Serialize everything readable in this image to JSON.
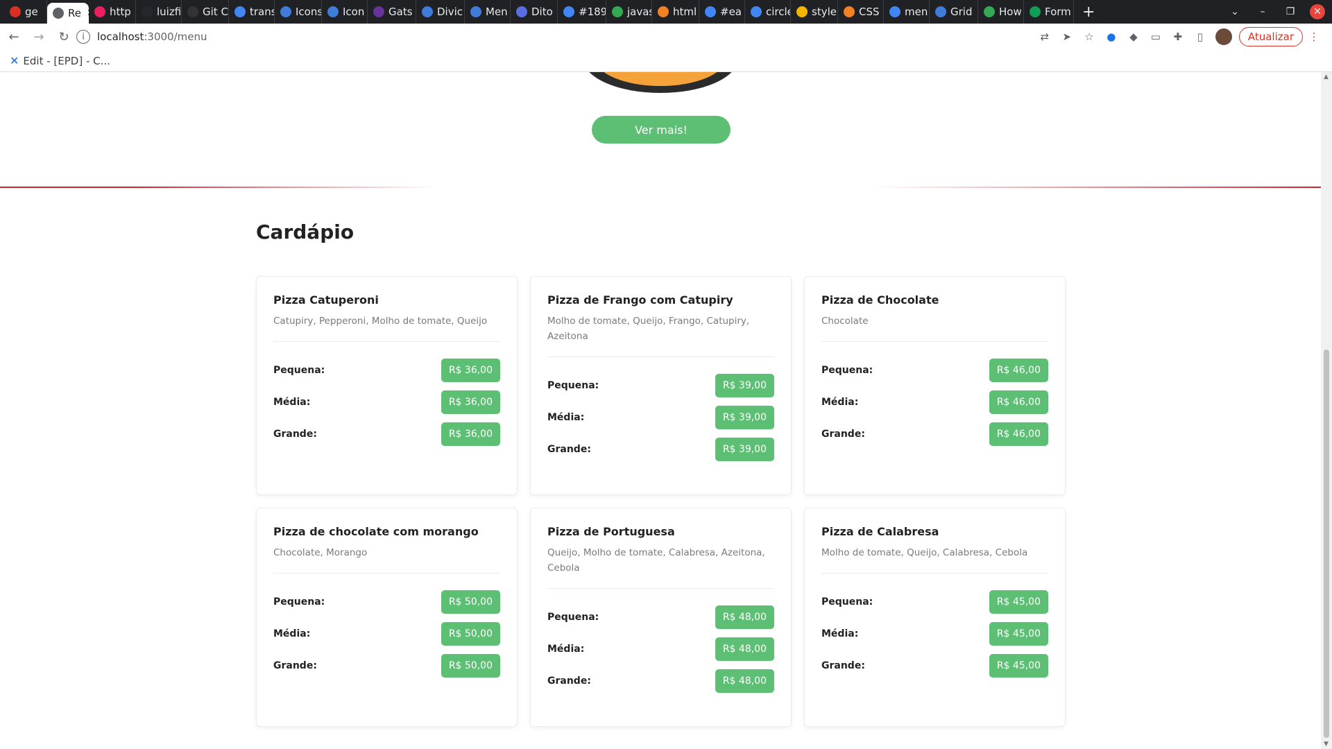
{
  "browser": {
    "tabs": [
      {
        "label": "ge",
        "icon": "gmail-icon",
        "color": "#d93025"
      },
      {
        "label": "Re",
        "icon": "loading-icon",
        "color": "#5f6368",
        "active": true
      },
      {
        "label": "http",
        "icon": "pink-circle-icon",
        "color": "#e91e63"
      },
      {
        "label": "luizfi",
        "icon": "github-icon",
        "color": "#24292e"
      },
      {
        "label": "Git C",
        "icon": "astro-icon",
        "color": "#333333"
      },
      {
        "label": "trans",
        "icon": "google-icon",
        "color": "#4285f4"
      },
      {
        "label": "Icons",
        "icon": "diamond-icon",
        "color": "#3f7bd9"
      },
      {
        "label": "Icon",
        "icon": "diamond-icon",
        "color": "#3f7bd9"
      },
      {
        "label": "Gats",
        "icon": "gatsby-icon",
        "color": "#663399"
      },
      {
        "label": "Divic",
        "icon": "diamond-icon",
        "color": "#3f7bd9"
      },
      {
        "label": "Men",
        "icon": "diamond-icon",
        "color": "#3f7bd9"
      },
      {
        "label": "Dito",
        "icon": "dito-icon",
        "color": "#5b6ee1"
      },
      {
        "label": "#189",
        "icon": "google-icon",
        "color": "#4285f4"
      },
      {
        "label": "javas",
        "icon": "spark-icon",
        "color": "#34a853"
      },
      {
        "label": "html",
        "icon": "stackoverflow-icon",
        "color": "#f48024"
      },
      {
        "label": "#ea",
        "icon": "google-icon",
        "color": "#4285f4"
      },
      {
        "label": "circle",
        "icon": "google-icon",
        "color": "#4285f4"
      },
      {
        "label": "style",
        "icon": "pencil-icon",
        "color": "#f4b400"
      },
      {
        "label": "CSS",
        "icon": "stackoverflow-icon",
        "color": "#f48024"
      },
      {
        "label": "men",
        "icon": "google-icon",
        "color": "#4285f4"
      },
      {
        "label": "Grid",
        "icon": "diamond-icon",
        "color": "#3f7bd9"
      },
      {
        "label": "How",
        "icon": "infinity-icon",
        "color": "#34a853"
      },
      {
        "label": "Form",
        "icon": "sheet-icon",
        "color": "#0f9d58"
      }
    ],
    "new_tab": "+",
    "url_host": "localhost",
    "url_path": ":3000/menu",
    "update_button": "Atualizar",
    "bookmark": "Edit - [EPD] - C..."
  },
  "page": {
    "see_more_button": "Ver mais!",
    "menu_title": "Cardápio",
    "sizes": [
      "Pequena:",
      "Média:",
      "Grande:"
    ],
    "pizzas": [
      {
        "name": "Pizza Catuperoni",
        "ingredients": "Catupiry, Pepperoni, Molho de tomate, Queijo",
        "prices": [
          "R$ 36,00",
          "R$ 36,00",
          "R$ 36,00"
        ]
      },
      {
        "name": "Pizza de Frango com Catupiry",
        "ingredients": "Molho de tomate, Queijo, Frango, Catupiry, Azeitona",
        "prices": [
          "R$ 39,00",
          "R$ 39,00",
          "R$ 39,00"
        ]
      },
      {
        "name": "Pizza de Chocolate",
        "ingredients": "Chocolate",
        "prices": [
          "R$ 46,00",
          "R$ 46,00",
          "R$ 46,00"
        ]
      },
      {
        "name": "Pizza de chocolate com morango",
        "ingredients": "Chocolate, Morango",
        "prices": [
          "R$ 50,00",
          "R$ 50,00",
          "R$ 50,00"
        ]
      },
      {
        "name": "Pizza de Portuguesa",
        "ingredients": "Queijo, Molho de tomate, Calabresa, Azeitona, Cebola",
        "prices": [
          "R$ 48,00",
          "R$ 48,00",
          "R$ 48,00"
        ]
      },
      {
        "name": "Pizza de Calabresa",
        "ingredients": "Molho de tomate, Queijo, Calabresa, Cebola",
        "prices": [
          "R$ 45,00",
          "R$ 45,00",
          "R$ 45,00"
        ]
      }
    ]
  },
  "colors": {
    "accent_green": "#5dbf74",
    "divider_red": "#d21f2b",
    "chrome_dark": "#202124"
  }
}
